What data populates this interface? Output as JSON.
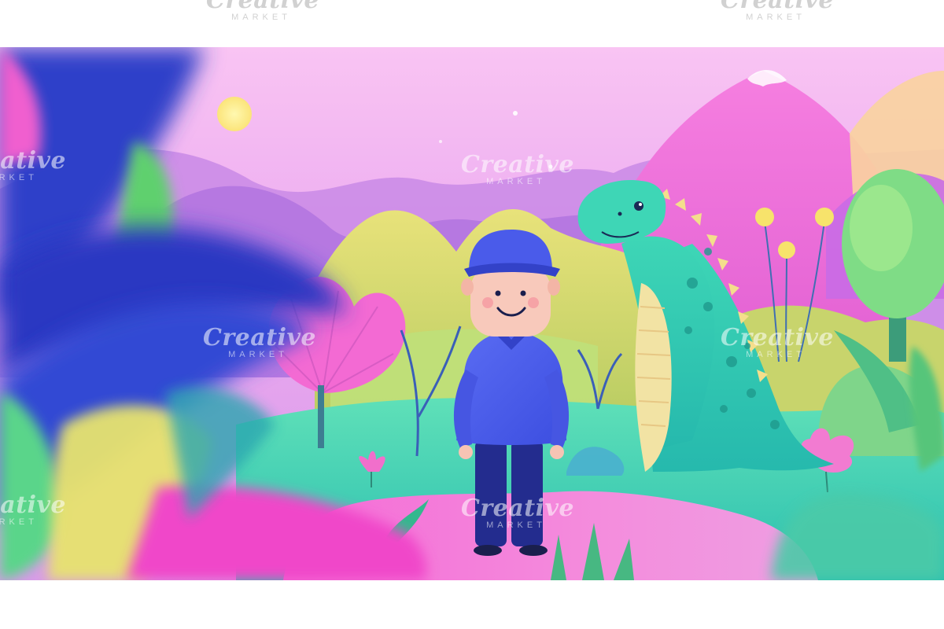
{
  "watermark": {
    "brand": "Creative",
    "sub": "MARKET"
  },
  "scene": {
    "palette": {
      "sky_top": "#f7b9f0",
      "sky_mid": "#e3a2ee",
      "mountain_purple": "#b276e0",
      "mountain_pink": "#f36fd8",
      "hill_yellow": "#cfd46a",
      "ground_teal": "#34d4b6",
      "path_pink": "#f07ad8",
      "dino_teal": "#2ec7ae",
      "dino_belly": "#f2e3a4",
      "boy_shirt": "#4d5ff0",
      "boy_pants": "#232c8e",
      "boy_cap": "#4a5bea",
      "foliage_blue": "#2e3fc9",
      "foliage_green": "#6fd36a"
    },
    "characters": [
      "boy-in-blue-cap",
      "green-dinosaur"
    ]
  }
}
